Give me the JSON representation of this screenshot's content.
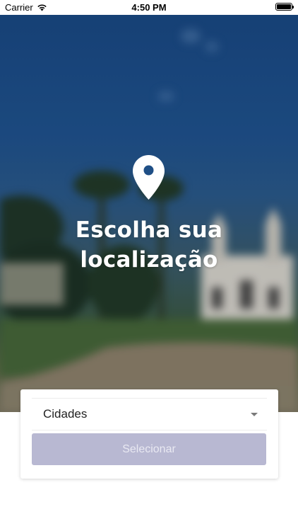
{
  "status_bar": {
    "carrier": "Carrier",
    "time": "4:50 PM",
    "wifi_icon": "wifi-icon",
    "battery_icon": "battery-icon"
  },
  "hero": {
    "icon": "location-pin-icon",
    "title_line1": "Escolha sua",
    "title_line2": "localização"
  },
  "form": {
    "select_value": "Cidades",
    "select_icon": "chevron-down-icon",
    "button_label": "Selecionar"
  },
  "colors": {
    "button_bg": "#b8b8d2",
    "button_text": "#e9e9f2",
    "hero_sky": "#1f5390"
  }
}
